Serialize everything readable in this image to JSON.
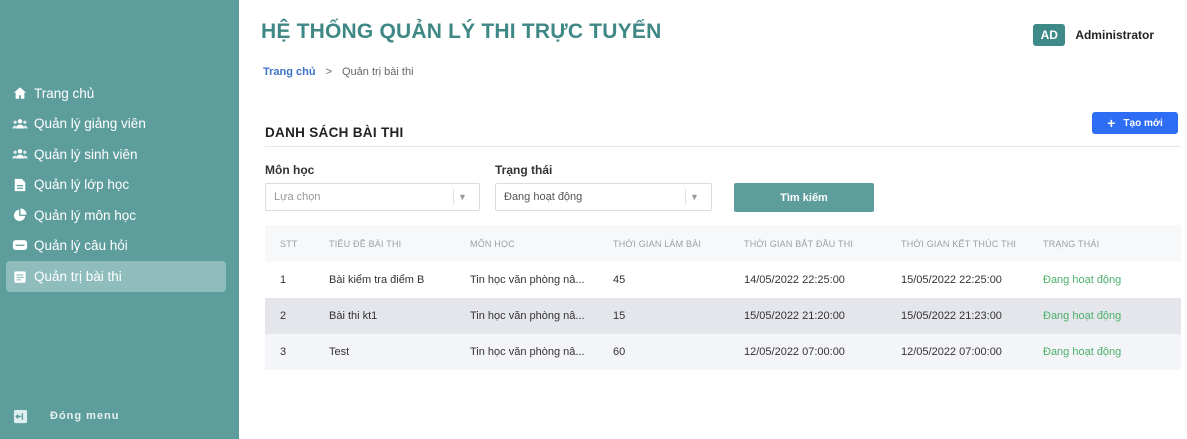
{
  "app": {
    "title": "HỆ THỐNG QUẢN LÝ THI TRỰC TUYẾN"
  },
  "user": {
    "initials": "AD",
    "name": "Administrator"
  },
  "breadcrumb": {
    "home": "Trang chủ",
    "separator": ">",
    "current": "Quản trị bài thi"
  },
  "sidebar": {
    "items": [
      {
        "label": "Trang chủ",
        "icon": "home-icon"
      },
      {
        "label": "Quản lý giảng viên",
        "icon": "users-icon"
      },
      {
        "label": "Quản lý sinh viên",
        "icon": "users-icon"
      },
      {
        "label": "Quản lý lớp học",
        "icon": "file-icon"
      },
      {
        "label": "Quản lý môn học",
        "icon": "pie-chart-icon"
      },
      {
        "label": "Quản lý câu hỏi",
        "icon": "message-icon"
      },
      {
        "label": "Quản trị bài thi",
        "icon": "document-icon",
        "active": true
      }
    ],
    "footer": {
      "label": "Đóng menu",
      "icon": "logout-icon"
    }
  },
  "page": {
    "section_title": "DANH SÁCH BÀI THI",
    "create_label": "Tạo mới",
    "filters": {
      "subject_label": "Môn học",
      "subject_placeholder": "Lựa chọn",
      "status_label": "Trạng thái",
      "status_value": "Đang hoạt động",
      "search_label": "Tìm kiếm"
    }
  },
  "table": {
    "headers": [
      "STT",
      "TIÊU ĐỀ BÀI THI",
      "MÔN HỌC",
      "THỜI GIAN LÀM BÀI",
      "THỜI GIAN BẮT ĐẦU THI",
      "THỜI GIAN KẾT THÚC THI",
      "TRẠNG THÁI"
    ],
    "rows": [
      [
        "1",
        "Bài kiểm tra điểm B",
        "Tin học văn phòng nâ...",
        "45",
        "14/05/2022 22:25:00",
        "15/05/2022 22:25:00",
        "Đang hoạt động"
      ],
      [
        "2",
        "Bài thi kt1",
        "Tin học văn phòng nâ...",
        "15",
        "15/05/2022 21:20:00",
        "15/05/2022 21:23:00",
        "Đang hoạt động"
      ],
      [
        "3",
        "Test",
        "Tin học văn phòng nâ...",
        "60",
        "12/05/2022 07:00:00",
        "12/05/2022 07:00:00",
        "Đang hoạt động"
      ]
    ]
  },
  "colors": {
    "sidebar": "#5d9d9c",
    "title": "#3f8886",
    "primary_button": "#2d6ef5",
    "status_active": "#4caf6a",
    "link": "#3b73c8"
  }
}
